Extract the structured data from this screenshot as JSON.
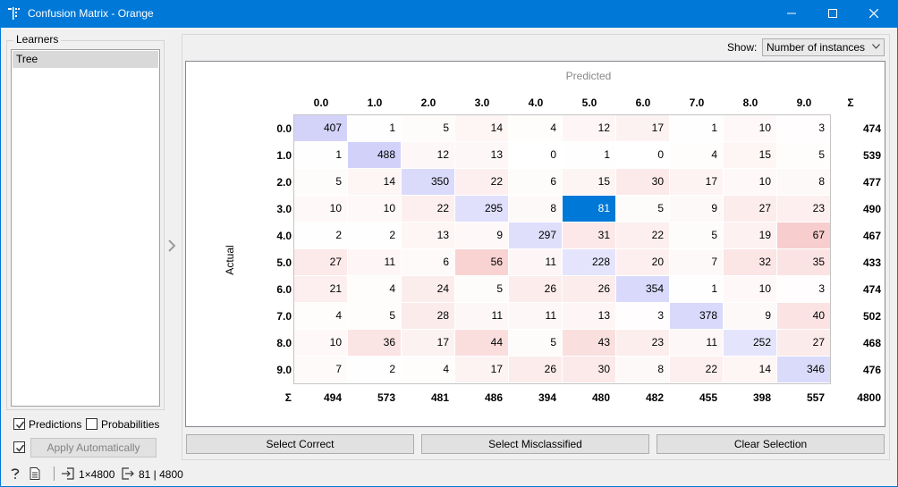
{
  "window": {
    "title": "Confusion Matrix - Orange"
  },
  "learners": {
    "title": "Learners",
    "items": [
      "Tree"
    ]
  },
  "options": {
    "predictions": {
      "label": "Predictions",
      "checked": true
    },
    "probabilities": {
      "label": "Probabilities",
      "checked": false
    },
    "apply_auto": {
      "label": "Apply Automatically",
      "checked": true
    }
  },
  "show": {
    "label": "Show:",
    "value": "Number of instances"
  },
  "matrix": {
    "predicted_label": "Predicted",
    "actual_label": "Actual",
    "classes": [
      "0.0",
      "1.0",
      "2.0",
      "3.0",
      "4.0",
      "5.0",
      "6.0",
      "7.0",
      "8.0",
      "9.0"
    ],
    "sum_symbol": "Σ",
    "values": [
      [
        407,
        1,
        5,
        14,
        4,
        12,
        17,
        1,
        10,
        3
      ],
      [
        1,
        488,
        12,
        13,
        0,
        1,
        0,
        4,
        15,
        5
      ],
      [
        5,
        14,
        350,
        22,
        6,
        15,
        30,
        17,
        10,
        8
      ],
      [
        10,
        10,
        22,
        295,
        8,
        81,
        5,
        9,
        27,
        23
      ],
      [
        2,
        2,
        13,
        9,
        297,
        31,
        22,
        5,
        19,
        67
      ],
      [
        27,
        11,
        6,
        56,
        11,
        228,
        20,
        7,
        32,
        35
      ],
      [
        21,
        4,
        24,
        5,
        26,
        26,
        354,
        1,
        10,
        3
      ],
      [
        4,
        5,
        28,
        11,
        11,
        13,
        3,
        378,
        9,
        40
      ],
      [
        10,
        36,
        17,
        44,
        5,
        43,
        23,
        11,
        252,
        27
      ],
      [
        7,
        2,
        4,
        17,
        26,
        30,
        8,
        22,
        14,
        346
      ]
    ],
    "row_sums": [
      474,
      539,
      477,
      490,
      467,
      433,
      474,
      502,
      468,
      476
    ],
    "col_sums": [
      494,
      573,
      481,
      486,
      394,
      480,
      482,
      455,
      398,
      557
    ],
    "total": 4800,
    "selected_cell": {
      "row": 3,
      "col": 5
    },
    "colors": {
      "correct": "#6e6ef0",
      "error": "#e65050",
      "selected": "#0078d7"
    }
  },
  "buttons": {
    "select_correct": "Select Correct",
    "select_misclassified": "Select Misclassified",
    "clear_selection": "Clear Selection"
  },
  "status": {
    "input_summary": "1×4800",
    "output_summary": "81 | 4800"
  }
}
